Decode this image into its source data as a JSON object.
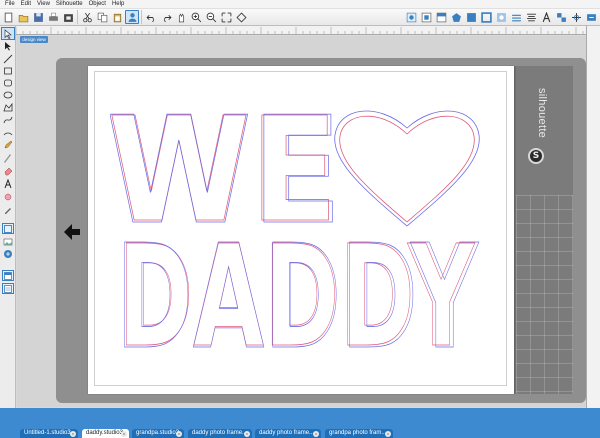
{
  "menu": [
    "File",
    "Edit",
    "View",
    "Silhouette",
    "Object",
    "Help"
  ],
  "toolbar_left_icons": [
    "new-file-icon",
    "open-file-icon",
    "save-icon",
    "print-icon",
    "store-icon",
    "cut-icon",
    "copy-icon",
    "paste-icon",
    "user-icon",
    "undo-icon",
    "redo-icon",
    "pan-icon",
    "zoom-in-icon",
    "zoom-out-icon",
    "zoom-fit-icon",
    "zoom-page-icon"
  ],
  "toolbar_right_icons": [
    "settings-icon",
    "design-page-icon",
    "media-icon",
    "cut-settings-icon",
    "fill-icon",
    "line-color-icon",
    "gradient-icon",
    "line-style-icon",
    "align-icon",
    "text-style-icon",
    "replicate-icon",
    "transform-icon",
    "send-to-silhouette-icon"
  ],
  "design_view_label": "design view",
  "brand": "silhouette",
  "brand_logo_letter": "S",
  "artwork_lines": [
    "WE",
    "DADDY"
  ],
  "heart": "heart",
  "tabs": [
    {
      "label": "Untitled-1.studio3",
      "active": false
    },
    {
      "label": "daddy.studio3",
      "active": true
    },
    {
      "label": "grandpa.studio3",
      "active": false
    },
    {
      "label": "daddy photo frame...",
      "active": false
    },
    {
      "label": "daddy photo frame...",
      "active": false
    },
    {
      "label": "grandpa photo fram...",
      "active": false
    }
  ],
  "tab_close": "x",
  "colors": {
    "cut_line_red": "#e05a7a",
    "cut_line_blue": "#6b6bea",
    "tabbar_bg": "#3d8ad1",
    "mat_gray": "#8f8f8f"
  }
}
